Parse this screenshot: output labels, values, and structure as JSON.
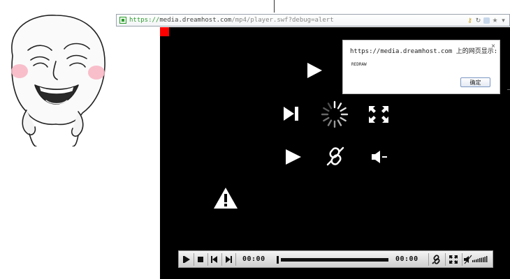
{
  "address_bar": {
    "url_scheme": "https://",
    "url_host": "media.dreamhost.com",
    "url_path": "/mp4/player.swf?debug=alert"
  },
  "alert": {
    "title": "https://media.dreamhost.com 上的网页显示:",
    "message": "REDRAW",
    "ok_label": "确定",
    "close_glyph": "×"
  },
  "controlbar": {
    "current_time": "00:00",
    "duration": "00:00",
    "progress": 0
  },
  "colors": {
    "player_bg": "#000000",
    "debug_marker": "#ff0000",
    "secure_green": "#2e9c2e"
  },
  "icons": [
    "play-icon",
    "next-icon",
    "loading-spinner-icon",
    "fullscreen-icon",
    "link-icon",
    "volume-icon",
    "warning-icon"
  ]
}
